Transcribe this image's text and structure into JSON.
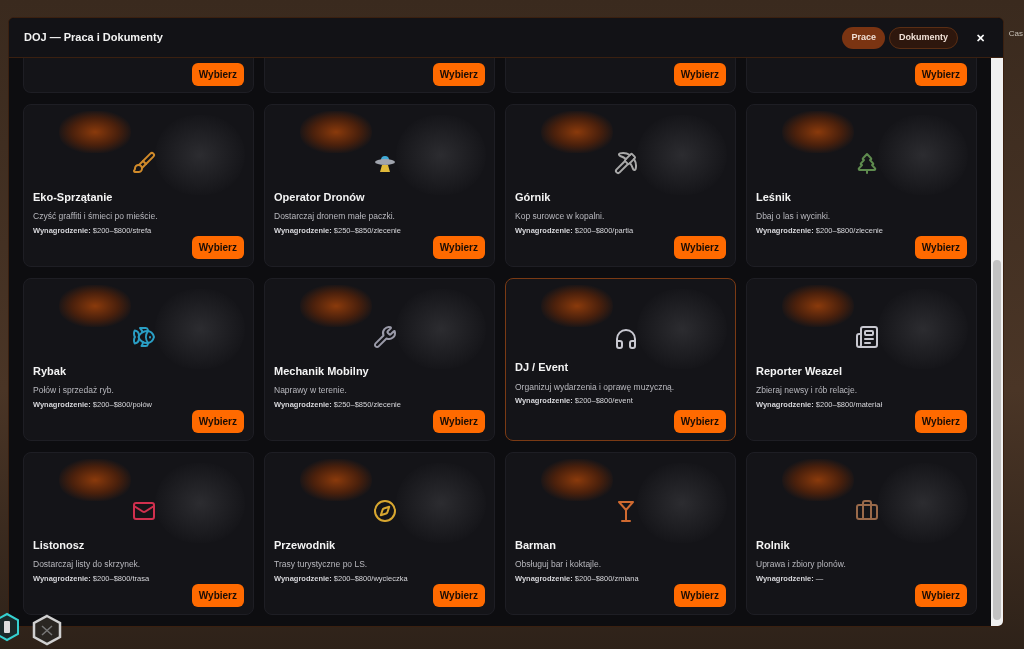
{
  "background": {
    "corner_text": "Cas"
  },
  "window": {
    "title": "DOJ — Praca i Dokumenty",
    "close": "✕"
  },
  "tabs": [
    {
      "label": "Prace",
      "selected": true
    },
    {
      "label": "Dokumenty",
      "selected": false
    }
  ],
  "partial_cards": [
    {
      "button": "Wybierz"
    },
    {
      "button": "Wybierz"
    },
    {
      "button": "Wybierz"
    },
    {
      "button": "Wybierz"
    }
  ],
  "jobs": [
    {
      "title": "Eko-Sprzątanie",
      "description": "Czyść graffiti i śmieci po mieście.",
      "wage_label": "Wynagrodzenie:",
      "wage": "$200–$800/strefa",
      "button": "Wybierz",
      "selected": false
    },
    {
      "title": "Operator Dronów",
      "description": "Dostarczaj dronem małe paczki.",
      "wage_label": "Wynagrodzenie:",
      "wage": "$250–$850/zlecenie",
      "button": "Wybierz",
      "selected": false
    },
    {
      "title": "Górnik",
      "description": "Kop surowce w kopalni.",
      "wage_label": "Wynagrodzenie:",
      "wage": "$200–$800/partia",
      "button": "Wybierz",
      "selected": false
    },
    {
      "title": "Leśnik",
      "description": "Dbaj o las i wycinki.",
      "wage_label": "Wynagrodzenie:",
      "wage": "$200–$800/zlecenie",
      "button": "Wybierz",
      "selected": false
    },
    {
      "title": "Rybak",
      "description": "Połów i sprzedaż ryb.",
      "wage_label": "Wynagrodzenie:",
      "wage": "$200–$800/połów",
      "button": "Wybierz",
      "selected": false
    },
    {
      "title": "Mechanik Mobilny",
      "description": "Naprawy w terenie.",
      "wage_label": "Wynagrodzenie:",
      "wage": "$250–$850/zlecenie",
      "button": "Wybierz",
      "selected": false
    },
    {
      "title": "DJ / Event",
      "description": "Organizuj wydarzenia i oprawę muzyczną.",
      "wage_label": "Wynagrodzenie:",
      "wage": "$200–$800/event",
      "button": "Wybierz",
      "selected": true
    },
    {
      "title": "Reporter Weazel",
      "description": "Zbieraj newsy i rób relacje.",
      "wage_label": "Wynagrodzenie:",
      "wage": "$200–$800/materiał",
      "button": "Wybierz",
      "selected": false
    },
    {
      "title": "Listonosz",
      "description": "Dostarczaj listy do skrzynek.",
      "wage_label": "Wynagrodzenie:",
      "wage": "$200–$800/trasa",
      "button": "Wybierz",
      "selected": false
    },
    {
      "title": "Przewodnik",
      "description": "Trasy turystyczne po LS.",
      "wage_label": "Wynagrodzenie:",
      "wage": "$200–$800/wycieczka",
      "button": "Wybierz",
      "selected": false
    },
    {
      "title": "Barman",
      "description": "Obsługuj bar i koktajle.",
      "wage_label": "Wynagrodzenie:",
      "wage": "$200–$800/zmiana",
      "button": "Wybierz",
      "selected": false
    },
    {
      "title": "Rolnik",
      "description": "Uprawa i zbiory plonów.",
      "wage_label": "Wynagrodzenie:",
      "wage": "—",
      "button": "Wybierz",
      "selected": false
    }
  ]
}
